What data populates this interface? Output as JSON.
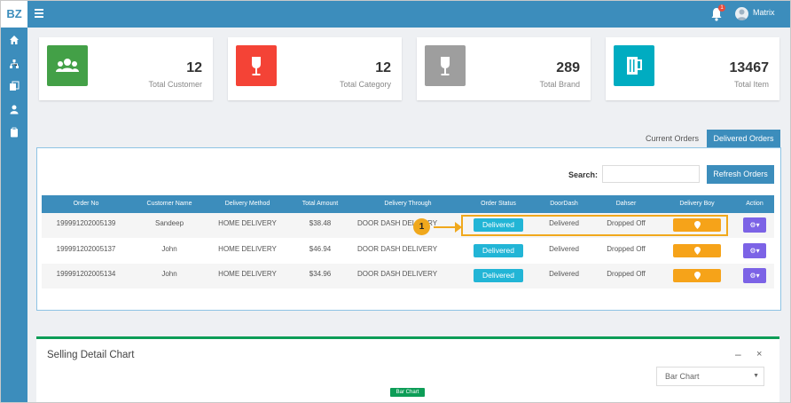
{
  "brand": {
    "logo": "BZ"
  },
  "topbar": {
    "menu_icon": "hamburger-icon",
    "notification_icon": "bell-icon",
    "notification_count": "1",
    "user_name": "Matrix"
  },
  "sidebar": {
    "items": [
      {
        "icon": "home-icon"
      },
      {
        "icon": "sitemap-icon"
      },
      {
        "icon": "copy-icon"
      },
      {
        "icon": "user-icon"
      },
      {
        "icon": "clipboard-icon"
      }
    ]
  },
  "stats": [
    {
      "value": "12",
      "label": "Total Customer",
      "color": "#43a047",
      "icon": "users-icon"
    },
    {
      "value": "12",
      "label": "Total Category",
      "color": "#f44336",
      "icon": "glass-icon"
    },
    {
      "value": "289",
      "label": "Total Brand",
      "color": "#9e9e9e",
      "icon": "glass-icon"
    },
    {
      "value": "13467",
      "label": "Total Item",
      "color": "#00acc1",
      "icon": "mug-icon"
    }
  ],
  "tabs": {
    "current": "Current Orders",
    "delivered": "Delivered Orders"
  },
  "search": {
    "label": "Search:",
    "value": ""
  },
  "refresh_label": "Refresh Orders",
  "table": {
    "headers": [
      "Order No",
      "Customer Name",
      "Delivery Method",
      "Total Amount",
      "Delivery Through",
      "Order Status",
      "DoorDash",
      "Dahser",
      "Delivery Boy",
      "Action"
    ],
    "rows": [
      {
        "order_no": "19999120200513​9",
        "customer": "Sandeep",
        "method": "HOME DELIVERY",
        "amount": "$38.48",
        "through": "DOOR DASH DELIVERY",
        "status": "Delivered",
        "doordash": "Delivered",
        "dasher": "Dropped Off"
      },
      {
        "order_no": "199991202005137",
        "customer": "John",
        "method": "HOME DELIVERY",
        "amount": "$46.94",
        "through": "DOOR DASH DELIVERY",
        "status": "Delivered",
        "doordash": "Delivered",
        "dasher": "Dropped Off"
      },
      {
        "order_no": "199991202005134",
        "customer": "John",
        "method": "HOME DELIVERY",
        "amount": "$34.96",
        "through": "DOOR DASH DELIVERY",
        "status": "Delivered",
        "doordash": "Delivered",
        "dasher": "Dropped Off"
      }
    ],
    "delivery_boy_icon": "map-marker-icon",
    "action_icon": "gear-icon"
  },
  "annotation": {
    "step": "1"
  },
  "chart_panel": {
    "title": "Selling Detail Chart",
    "minimize": "–",
    "close": "×",
    "select_value": "Bar Chart",
    "legend_label": "Bar Chart"
  },
  "colors": {
    "primary": "#3c8dbc",
    "info": "#22b5d6",
    "warning": "#f6a319",
    "action": "#7c63e6",
    "success": "#0d9d57",
    "highlight": "#f0a81c"
  }
}
